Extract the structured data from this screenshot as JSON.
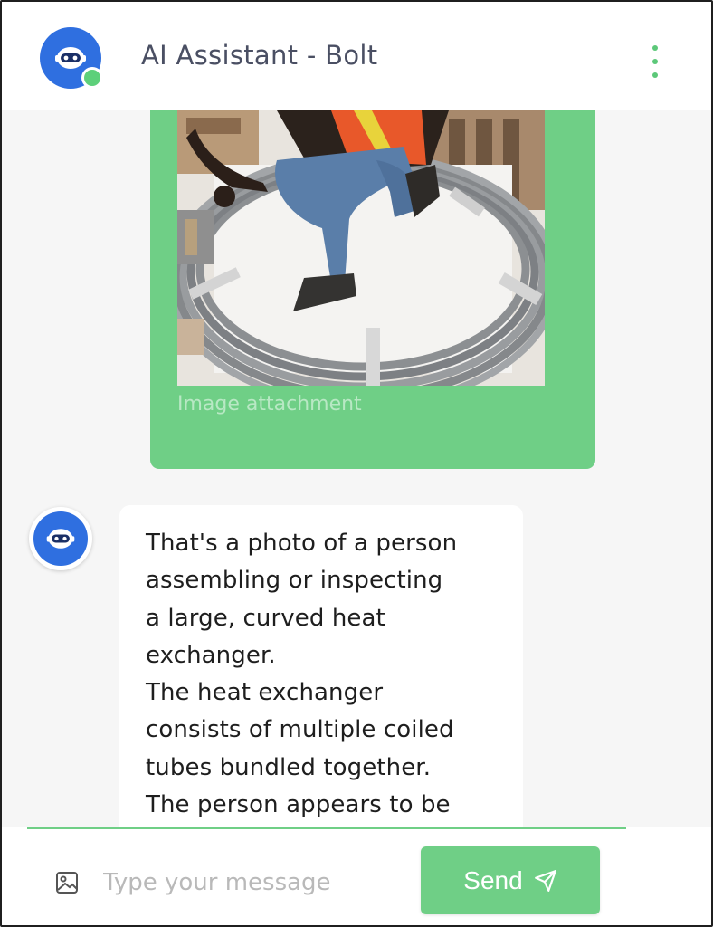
{
  "header": {
    "title": "AI Assistant - Bolt",
    "avatar_icon": "robot-icon",
    "status": "online",
    "menu_icon": "more-vertical-icon"
  },
  "messages": [
    {
      "sender": "user",
      "type": "image",
      "caption": "Image attachment"
    },
    {
      "sender": "bot",
      "type": "text",
      "lines": [
        "That's a photo of a person",
        "assembling or inspecting",
        "a large, curved heat",
        "exchanger.",
        "The heat exchanger",
        "consists of multiple coiled",
        "tubes bundled together.",
        "The person appears to be"
      ]
    }
  ],
  "composer": {
    "placeholder": "Type your message",
    "send_label": "Send",
    "attach_icon": "image-icon",
    "send_icon": "send-icon"
  },
  "colors": {
    "accent": "#6fcf86",
    "avatar": "#2f6fe0",
    "chat_bg": "#f6f6f6",
    "title": "#4a4f63"
  }
}
